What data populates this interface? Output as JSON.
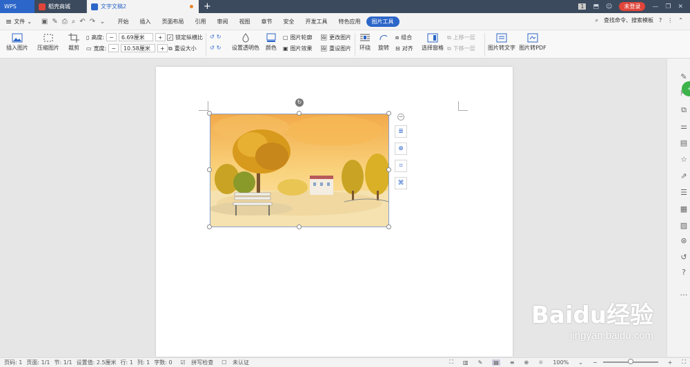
{
  "titlebar": {
    "tabs": [
      {
        "label": "WPS"
      },
      {
        "label": "稻壳商城"
      },
      {
        "label": "文字文稿2"
      }
    ],
    "new_tab": "+",
    "login_label": "未登录",
    "page_badge": "1"
  },
  "menubar": {
    "file_label": "文件",
    "items": [
      "开始",
      "插入",
      "页面布局",
      "引用",
      "审阅",
      "视图",
      "章节",
      "安全",
      "开发工具",
      "特色应用",
      "图片工具"
    ],
    "active_index": 10,
    "search_label": "查找命令、搜索模板"
  },
  "ribbon": {
    "insert_image": "插入图片",
    "compress_image": "压缩图片",
    "crop": "裁剪",
    "height_label": "高度:",
    "height_value": "6.69厘米",
    "width_label": "宽度:",
    "width_value": "10.58厘米",
    "lock_ratio": "锁定纵横比",
    "reset_size": "重设大小",
    "set_transparent": "设置透明色",
    "color": "颜色",
    "image_outline": "图片轮廓",
    "image_effect": "图片效果",
    "change_image": "更改图片",
    "reset_image": "重设图片",
    "wrap": "环绕",
    "rotate": "旋转",
    "group": "组合",
    "align": "对齐",
    "selection_pane": "选择窗格",
    "bring_forward": "上移一层",
    "send_backward": "下移一层",
    "image_to_text": "图片转文字",
    "image_to_pdf": "图片转PDF"
  },
  "statusbar": {
    "page_code": "页码: 1",
    "page": "页面: 1/1",
    "section": "节: 1/1",
    "setting": "设置值: 2.5厘米",
    "row": "行: 1",
    "col": "列: 1",
    "word_count": "字数: 0",
    "spell_check": "拼写检查",
    "not_certified": "未认证",
    "zoom": "100%",
    "zoom_level": 0.5
  },
  "watermark": {
    "brand": "Baidu经验",
    "url": "jingyan.baidu.com"
  },
  "colors": {
    "accent": "#2c66c8",
    "titlebar": "#3c4a5e",
    "login_red": "#e0453a"
  }
}
